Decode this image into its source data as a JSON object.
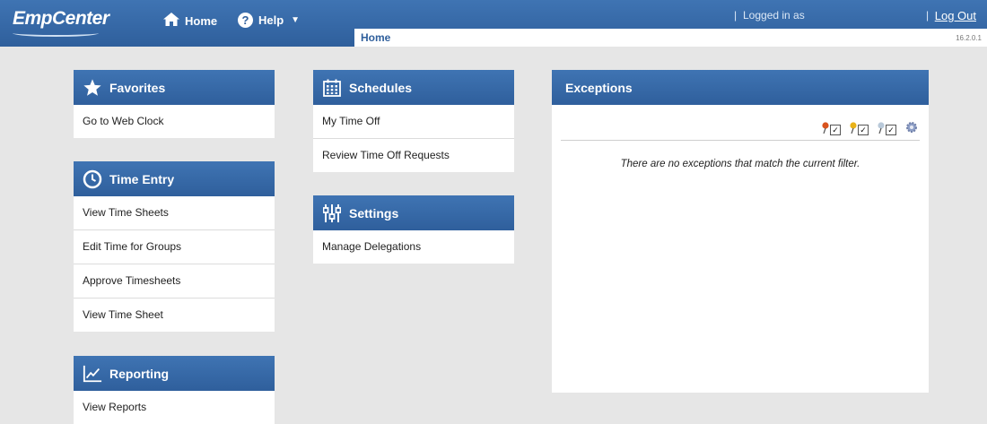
{
  "header": {
    "logo": "EmpCenter",
    "nav_home": "Home",
    "nav_help": "Help",
    "logged_in": "Logged in as",
    "separator": "|",
    "logout": "Log Out",
    "breadcrumb": "Home",
    "version": "16.2.0.1"
  },
  "favorites": {
    "title": "Favorites",
    "items": [
      "Go to Web Clock"
    ]
  },
  "time_entry": {
    "title": "Time Entry",
    "items": [
      "View Time Sheets",
      "Edit Time for Groups",
      "Approve Timesheets",
      "View Time Sheet"
    ]
  },
  "reporting": {
    "title": "Reporting",
    "items": [
      "View Reports"
    ]
  },
  "schedules": {
    "title": "Schedules",
    "items": [
      "My Time Off",
      "Review Time Off Requests"
    ]
  },
  "settings": {
    "title": "Settings",
    "items": [
      "Manage Delegations"
    ]
  },
  "exceptions": {
    "title": "Exceptions",
    "empty_message": "There are no exceptions that match the current filter.",
    "filters": [
      {
        "name": "high",
        "color": "#d9531e"
      },
      {
        "name": "medium",
        "color": "#e9b31a"
      },
      {
        "name": "low",
        "color": "#b9c9d9"
      }
    ]
  },
  "colors": {
    "accent": "#2f5f9c",
    "background": "#e6e6e6"
  }
}
